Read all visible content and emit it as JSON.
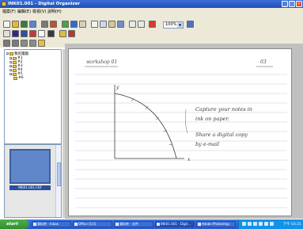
{
  "window": {
    "title": "INK01.001 - Digital Organizer",
    "controls": [
      "_",
      "□",
      "×"
    ]
  },
  "menu": {
    "items": [
      "檔案(F)",
      "編輯(E)",
      "檢視(V)",
      "說明(H)"
    ]
  },
  "toolbar": {
    "zoom_value": "100%"
  },
  "tree": {
    "root_label": "我的電腦",
    "items": [
      "#1",
      "#2",
      "#3",
      "#4",
      "#5",
      "#6"
    ]
  },
  "thumbnails": {
    "selected_label": "INK01.001.FDF"
  },
  "note": {
    "header_left": "workshop 01",
    "header_right": "03",
    "axis_y": "y",
    "axis_x": "x",
    "annotation_1_line_1": "Capture your notes in",
    "annotation_1_line_2": "ink on paper.",
    "annotation_2_line_1": "Share a digital copy",
    "annotation_2_line_2": "by e-mail"
  },
  "taskbar": {
    "start_label": "start",
    "tasks": [
      "資料夾 - Inbox",
      "Office (1/3)",
      "資料夾 - 文件",
      "INK01.001 - Digit...",
      "Adobe Photoshop"
    ],
    "clock": "下午 03:21"
  },
  "colors": {
    "titlebar": "#2b5fcc",
    "taskbar": "#245bd0",
    "start_button": "#3a9a35",
    "ink": "#3a3a3a",
    "paper_lines": "#c8c8c8"
  }
}
